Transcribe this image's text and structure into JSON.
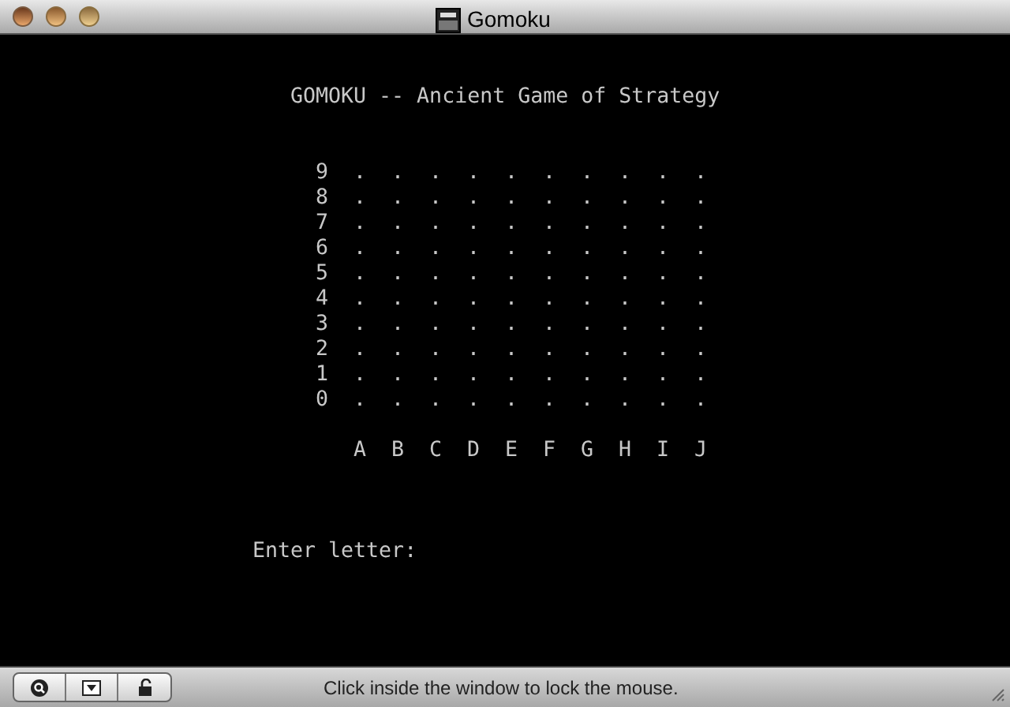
{
  "window": {
    "title": "Gomoku"
  },
  "terminal": {
    "heading": "GOMOKU -- Ancient Game of Strategy",
    "board_lines": [
      {
        "label": "9",
        "points": [
          ".",
          ".",
          ".",
          ".",
          ".",
          ".",
          ".",
          ".",
          ".",
          "."
        ]
      },
      {
        "label": "8",
        "points": [
          ".",
          ".",
          ".",
          ".",
          ".",
          ".",
          ".",
          ".",
          ".",
          "."
        ]
      },
      {
        "label": "7",
        "points": [
          ".",
          ".",
          ".",
          ".",
          ".",
          ".",
          ".",
          ".",
          ".",
          "."
        ]
      },
      {
        "label": "6",
        "points": [
          ".",
          ".",
          ".",
          ".",
          ".",
          ".",
          ".",
          ".",
          ".",
          "."
        ]
      },
      {
        "label": "5",
        "points": [
          ".",
          ".",
          ".",
          ".",
          ".",
          ".",
          ".",
          ".",
          ".",
          "."
        ]
      },
      {
        "label": "4",
        "points": [
          ".",
          ".",
          ".",
          ".",
          ".",
          ".",
          ".",
          ".",
          ".",
          "."
        ]
      },
      {
        "label": "3",
        "points": [
          ".",
          ".",
          ".",
          ".",
          ".",
          ".",
          ".",
          ".",
          ".",
          "."
        ]
      },
      {
        "label": "2",
        "points": [
          ".",
          ".",
          ".",
          ".",
          ".",
          ".",
          ".",
          ".",
          ".",
          "."
        ]
      },
      {
        "label": "1",
        "points": [
          ".",
          ".",
          ".",
          ".",
          ".",
          ".",
          ".",
          ".",
          ".",
          "."
        ]
      },
      {
        "label": "0",
        "points": [
          ".",
          ".",
          ".",
          ".",
          ".",
          ".",
          ".",
          ".",
          ".",
          "."
        ]
      }
    ],
    "letters": [
      "A",
      "B",
      "C",
      "D",
      "E",
      "F",
      "G",
      "H",
      "I",
      "J"
    ],
    "prompt": "Enter letter:"
  },
  "status_bar": {
    "message": "Click inside the window to lock the mouse."
  }
}
